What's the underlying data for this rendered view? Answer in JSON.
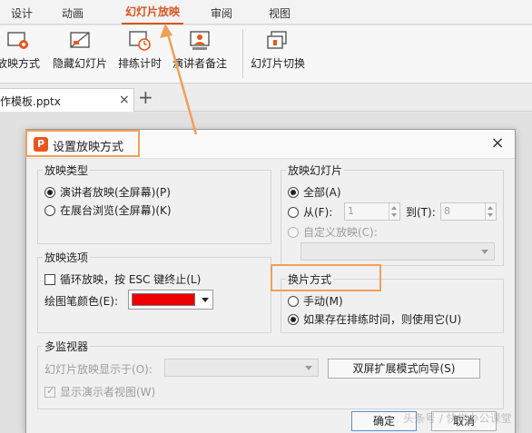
{
  "ribbon": {
    "tabs": [
      {
        "label": "设计"
      },
      {
        "label": "动画"
      },
      {
        "label": "幻灯片放映"
      },
      {
        "label": "审阅"
      },
      {
        "label": "视图"
      }
    ],
    "buttons": [
      {
        "label": "放映方式",
        "icon": "slideshow-settings-icon"
      },
      {
        "label": "隐藏幻灯片",
        "icon": "hide-slide-icon"
      },
      {
        "label": "排练计时",
        "icon": "rehearse-timing-icon"
      },
      {
        "label": "演讲者备注",
        "icon": "speaker-notes-icon"
      },
      {
        "label": "幻灯片切换",
        "icon": "slide-transition-icon"
      }
    ]
  },
  "doc_tabs": {
    "active_file": "作模板.pptx",
    "close": "×",
    "add": "+"
  },
  "dialog": {
    "title": "设置放映方式",
    "close": "×",
    "show_type": {
      "label": "放映类型",
      "options": [
        "演讲者放映(全屏幕)(P)",
        "在展台浏览(全屏幕)(K)"
      ],
      "selected": 0
    },
    "show_slides": {
      "label": "放映幻灯片",
      "all": "全部(A)",
      "from": "从(F):",
      "from_value": "1",
      "to": "到(T):",
      "to_value": "8",
      "custom": "自定义放映(C):"
    },
    "show_options": {
      "label": "放映选项",
      "loop": "循环放映，按 ESC 键终止(L)",
      "pen_color": "绘图笔颜色(E):",
      "pen_color_value": "#ee0000"
    },
    "advance": {
      "label": "换片方式",
      "manual": "手动(M)",
      "timings": "如果存在排练时间，则使用它(U)"
    },
    "monitors": {
      "label": "多监视器",
      "display_on": "幻灯片放映显示于(O):",
      "wizard": "双屏扩展模式向导(S)",
      "presenter_view": "显示演示者视图(W)"
    },
    "ok": "确定",
    "cancel": "取消"
  },
  "watermark": "头条号 / 快学办公课堂",
  "colors": {
    "accent": "#d9541e",
    "highlight": "#f0a05a"
  }
}
